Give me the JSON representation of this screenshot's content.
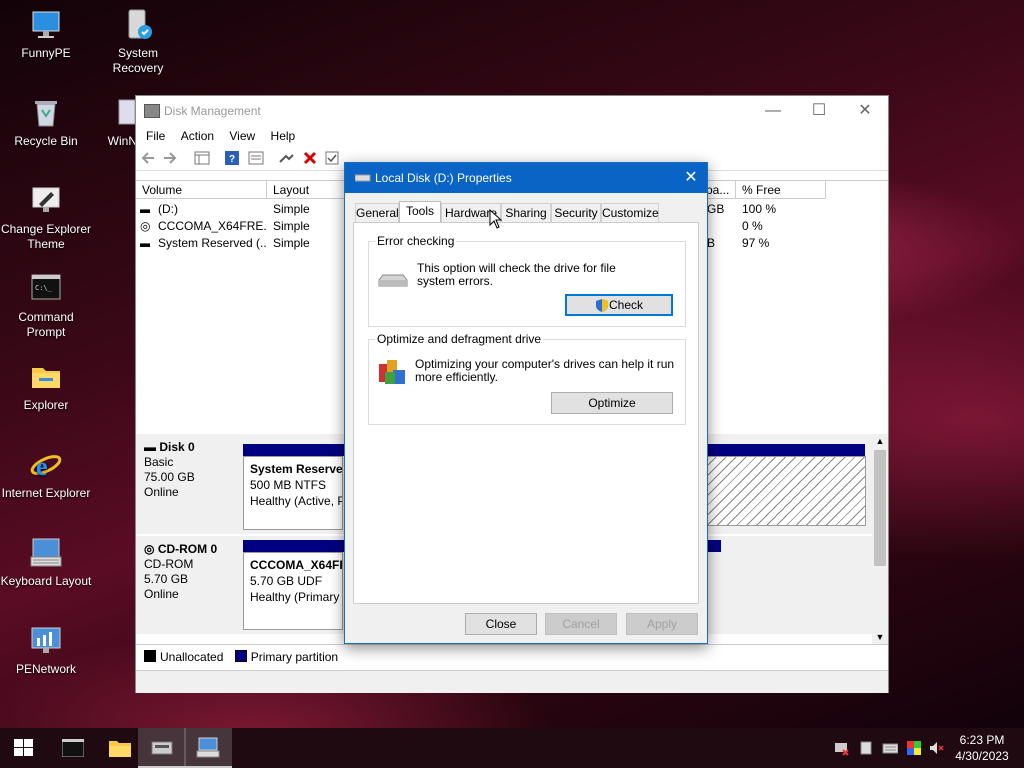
{
  "desktop": {
    "icons": [
      {
        "label": "FunnyPE",
        "icon": "monitor-icon"
      },
      {
        "label": "System Recovery",
        "icon": "recovery-icon"
      },
      {
        "label": "Recycle Bin",
        "icon": "recycle-bin-icon"
      },
      {
        "label": "WinNT",
        "icon": "setup-icon"
      },
      {
        "label": "Change Explorer Theme",
        "icon": "theme-icon"
      },
      {
        "label": "Command Prompt",
        "icon": "terminal-icon"
      },
      {
        "label": "Explorer",
        "icon": "folder-icon"
      },
      {
        "label": "Internet Explorer",
        "icon": "ie-icon"
      },
      {
        "label": "Keyboard Layout",
        "icon": "keyboard-icon"
      },
      {
        "label": "PENetwork",
        "icon": "network-icon"
      }
    ]
  },
  "disk_management": {
    "title": "Disk Management",
    "menu": [
      "File",
      "Action",
      "View",
      "Help"
    ],
    "columns": [
      "Volume",
      "Layout",
      "pa...",
      "% Free"
    ],
    "volumes": [
      {
        "volume": "(D:)",
        "layout": "Simple",
        "cap": "GB",
        "free": "100 %"
      },
      {
        "volume": "CCCOMA_X64FRE...",
        "layout": "Simple",
        "cap": "",
        "free": "0 %"
      },
      {
        "volume": "System Reserved (...",
        "layout": "Simple",
        "cap": "B",
        "free": "97 %"
      }
    ],
    "disks": [
      {
        "name": "Disk 0",
        "type": "Basic",
        "size": "75.00 GB",
        "status": "Online",
        "partition": {
          "name": "System Reserved",
          "detail": "500 MB NTFS",
          "health": "Healthy (Active, P"
        }
      },
      {
        "name": "CD-ROM 0",
        "type": "CD-ROM",
        "size": "5.70 GB",
        "status": "Online",
        "partition": {
          "name": "CCCOMA_X64FRE",
          "detail": "5.70 GB UDF",
          "health": "Healthy (Primary P"
        }
      }
    ],
    "legend": {
      "unallocated": "Unallocated",
      "primary": "Primary partition"
    }
  },
  "dialog": {
    "title": "Local Disk (D:) Properties",
    "tabs": [
      "General",
      "Tools",
      "Hardware",
      "Sharing",
      "Security",
      "Customize"
    ],
    "selected_tab": "Tools",
    "error_checking": {
      "label": "Error checking",
      "text1": "This option will check the drive for file",
      "text2": "system errors.",
      "button": "Check"
    },
    "optimize": {
      "label": "Optimize and defragment drive",
      "text1": "Optimizing your computer's drives can help it run",
      "text2": "more efficiently.",
      "button": "Optimize"
    },
    "buttons": {
      "close": "Close",
      "cancel": "Cancel",
      "apply": "Apply"
    }
  },
  "taskbar": {
    "time": "6:23 PM",
    "date": "4/30/2023"
  },
  "colors": {
    "dialog_title_bg": "#0a64c6",
    "partition_bar": "#000080",
    "focus_border": "#0078d7"
  }
}
